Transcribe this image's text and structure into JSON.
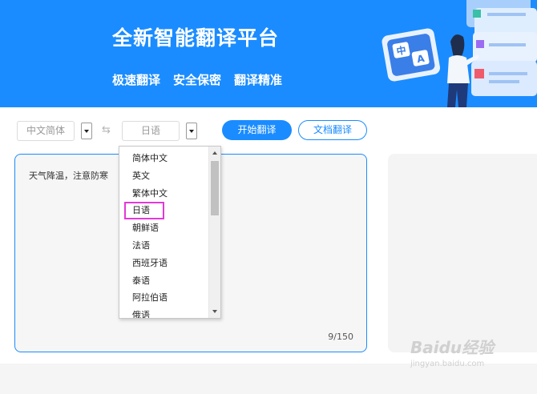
{
  "banner": {
    "title": "全新智能翻译平台",
    "features": [
      "极速翻译",
      "安全保密",
      "翻译精准"
    ],
    "illustration_icon_text": {
      "zh": "中",
      "en": "A"
    }
  },
  "toolbar": {
    "source_language": "中文简体",
    "target_language": "日语",
    "swap_icon": "⇆",
    "start_button": "开始翻译",
    "document_button": "文档翻译"
  },
  "source_pane": {
    "text": "天气降温，注意防寒",
    "char_count": "9/150"
  },
  "dropdown": {
    "items": [
      "简体中文",
      "英文",
      "繁体中文",
      "日语",
      "朝鲜语",
      "法语",
      "西班牙语",
      "泰语",
      "阿拉伯语",
      "俄语"
    ],
    "selected_index": 3
  },
  "watermark": {
    "main": "Baidu经验",
    "sub": "jingyan.baidu.com"
  },
  "colors": {
    "brand": "#1a8cff",
    "highlight": "#e23ad8"
  }
}
